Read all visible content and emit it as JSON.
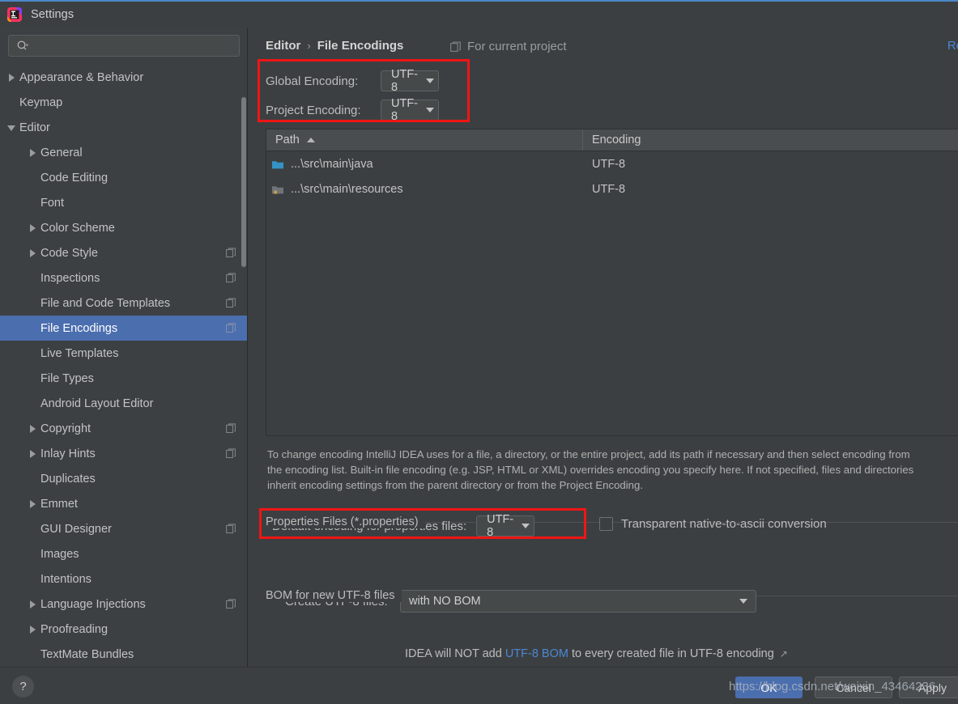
{
  "window": {
    "title": "Settings",
    "logo_icon": "intellij-idea-logo"
  },
  "search": {
    "value": "",
    "placeholder": "",
    "icon": "search-icon"
  },
  "sidebar": {
    "items": [
      {
        "label": "Appearance & Behavior",
        "level": 0,
        "arrow": "closed",
        "copy": false,
        "selected": false
      },
      {
        "label": "Keymap",
        "level": 0,
        "arrow": "none",
        "copy": false,
        "selected": false
      },
      {
        "label": "Editor",
        "level": 0,
        "arrow": "open",
        "copy": false,
        "selected": false
      },
      {
        "label": "General",
        "level": 1,
        "arrow": "closed",
        "copy": false,
        "selected": false
      },
      {
        "label": "Code Editing",
        "level": 1,
        "arrow": "none",
        "copy": false,
        "selected": false
      },
      {
        "label": "Font",
        "level": 1,
        "arrow": "none",
        "copy": false,
        "selected": false
      },
      {
        "label": "Color Scheme",
        "level": 1,
        "arrow": "closed",
        "copy": false,
        "selected": false
      },
      {
        "label": "Code Style",
        "level": 1,
        "arrow": "closed",
        "copy": true,
        "selected": false
      },
      {
        "label": "Inspections",
        "level": 1,
        "arrow": "none",
        "copy": true,
        "selected": false
      },
      {
        "label": "File and Code Templates",
        "level": 1,
        "arrow": "none",
        "copy": true,
        "selected": false
      },
      {
        "label": "File Encodings",
        "level": 1,
        "arrow": "none",
        "copy": true,
        "selected": true
      },
      {
        "label": "Live Templates",
        "level": 1,
        "arrow": "none",
        "copy": false,
        "selected": false
      },
      {
        "label": "File Types",
        "level": 1,
        "arrow": "none",
        "copy": false,
        "selected": false
      },
      {
        "label": "Android Layout Editor",
        "level": 1,
        "arrow": "none",
        "copy": false,
        "selected": false
      },
      {
        "label": "Copyright",
        "level": 1,
        "arrow": "closed",
        "copy": true,
        "selected": false
      },
      {
        "label": "Inlay Hints",
        "level": 1,
        "arrow": "closed",
        "copy": true,
        "selected": false
      },
      {
        "label": "Duplicates",
        "level": 1,
        "arrow": "none",
        "copy": false,
        "selected": false
      },
      {
        "label": "Emmet",
        "level": 1,
        "arrow": "closed",
        "copy": false,
        "selected": false
      },
      {
        "label": "GUI Designer",
        "level": 1,
        "arrow": "none",
        "copy": true,
        "selected": false
      },
      {
        "label": "Images",
        "level": 1,
        "arrow": "none",
        "copy": false,
        "selected": false
      },
      {
        "label": "Intentions",
        "level": 1,
        "arrow": "none",
        "copy": false,
        "selected": false
      },
      {
        "label": "Language Injections",
        "level": 1,
        "arrow": "closed",
        "copy": true,
        "selected": false
      },
      {
        "label": "Proofreading",
        "level": 1,
        "arrow": "closed",
        "copy": false,
        "selected": false
      },
      {
        "label": "TextMate Bundles",
        "level": 1,
        "arrow": "none",
        "copy": false,
        "selected": false
      }
    ]
  },
  "main": {
    "breadcrumb": {
      "parent": "Editor",
      "separator": "›",
      "current": "File Encodings"
    },
    "scope": {
      "label": "For current project",
      "icon": "copy-scope-icon"
    },
    "reset_link": "Re",
    "global_encoding": {
      "label": "Global Encoding:",
      "value": "UTF-8"
    },
    "project_encoding": {
      "label": "Project Encoding:",
      "value": "UTF-8"
    },
    "table": {
      "columns": [
        "Path",
        "Encoding"
      ],
      "sort_column": "Path",
      "sort_direction": "asc",
      "rows": [
        {
          "icon": "folder-icon",
          "path": "...\\src\\main\\java",
          "encoding": "UTF-8"
        },
        {
          "icon": "resources-folder-icon",
          "path": "...\\src\\main\\resources",
          "encoding": "UTF-8"
        }
      ]
    },
    "hint": "To change encoding IntelliJ IDEA uses for a file, a directory, or the entire project, add its path if necessary and then select encoding from\nthe encoding list. Built-in file encoding (e.g. JSP, HTML or XML) overrides encoding you specify here. If not specified, files and directories\ninherit encoding settings from the parent directory or from the Project Encoding.",
    "properties_group": {
      "title": "Properties Files (*.properties)",
      "default_encoding_label": "Default encoding for properties files:",
      "default_encoding_value": "UTF-8",
      "transparent_label": "Transparent native-to-ascii conversion",
      "transparent_checked": false
    },
    "bom_group": {
      "title": "BOM for new UTF-8 files",
      "create_label": "Create UTF-8 files:",
      "create_value": "with NO BOM",
      "note_prefix": "IDEA will NOT add",
      "note_link": "UTF-8 BOM",
      "note_suffix": "to every created file in UTF-8 encoding",
      "ext_icon": "external-link-icon"
    }
  },
  "bottom": {
    "help_label": "?",
    "ok_label": "OK",
    "cancel_label": "Cancel",
    "apply_label": "Apply",
    "watermark": "https://blog.csdn.net/weixin_43464236"
  },
  "colors": {
    "accent_selection": "#4b6eaf",
    "highlight_box": "#f01515",
    "link": "#4c87d4",
    "window_bg": "#3c3f41",
    "sidebar_bg": "#3c4043",
    "titlebar_accent": "#4a88c7"
  }
}
